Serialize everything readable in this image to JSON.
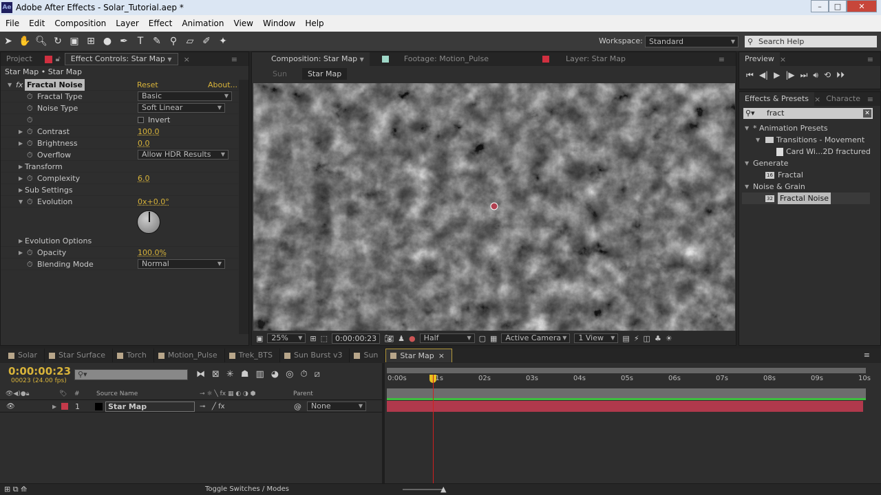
{
  "window": {
    "app_icon": "Ae",
    "title": "Adobe After Effects - Solar_Tutorial.aep *"
  },
  "menu": [
    "File",
    "Edit",
    "Composition",
    "Layer",
    "Effect",
    "Animation",
    "View",
    "Window",
    "Help"
  ],
  "toolbar": {
    "workspace_label": "Workspace:",
    "workspace_value": "Standard",
    "search_placeholder": "Search Help"
  },
  "left_panel": {
    "tabs": [
      "Project",
      "Effect Controls: Star Map"
    ],
    "breadcrumb": "Star Map • Star Map",
    "effect": {
      "name": "Fractal Noise",
      "reset": "Reset",
      "about": "About...",
      "properties": [
        {
          "label": "Fractal Type",
          "value": "Basic",
          "kind": "dropdown"
        },
        {
          "label": "Noise Type",
          "value": "Soft Linear",
          "kind": "dropdown"
        },
        {
          "label": "",
          "value": "Invert",
          "kind": "checkbox",
          "checked": false
        },
        {
          "label": "Contrast",
          "value": "100.0",
          "kind": "number"
        },
        {
          "label": "Brightness",
          "value": "0.0",
          "kind": "number"
        },
        {
          "label": "Overflow",
          "value": "Allow HDR Results",
          "kind": "dropdown"
        },
        {
          "label": "Transform",
          "value": "",
          "kind": "group"
        },
        {
          "label": "Complexity",
          "value": "6.0",
          "kind": "number"
        },
        {
          "label": "Sub Settings",
          "value": "",
          "kind": "group"
        },
        {
          "label": "Evolution",
          "value": "0x+0.0°",
          "kind": "number"
        },
        {
          "label": "Evolution Options",
          "value": "",
          "kind": "group"
        },
        {
          "label": "Opacity",
          "value": "100.0%",
          "kind": "number"
        },
        {
          "label": "Blending Mode",
          "value": "Normal",
          "kind": "dropdown"
        }
      ]
    }
  },
  "viewer": {
    "tabs": [
      "Composition: Star Map",
      "Footage: Motion_Pulse",
      "Layer: Star Map"
    ],
    "flow": [
      "Sun",
      "Star Map"
    ],
    "footer": {
      "zoom": "25%",
      "timecode": "0:00:00:23",
      "resolution": "Half",
      "camera": "Active Camera",
      "views": "1 View"
    }
  },
  "preview": {
    "tab": "Preview"
  },
  "effects_presets": {
    "tabs": [
      "Effects & Presets",
      "Characte"
    ],
    "search": "fract",
    "tree": [
      {
        "label": "* Animation Presets",
        "depth": 0,
        "type": "category"
      },
      {
        "label": "Transitions - Movement",
        "depth": 1,
        "type": "folder"
      },
      {
        "label": "Card Wi...2D fractured",
        "depth": 2,
        "type": "preset"
      },
      {
        "label": "Generate",
        "depth": 0,
        "type": "category"
      },
      {
        "label": "Fractal",
        "depth": 1,
        "type": "effect",
        "bits": "16"
      },
      {
        "label": "Noise & Grain",
        "depth": 0,
        "type": "category"
      },
      {
        "label": "Fractal Noise",
        "depth": 1,
        "type": "effect",
        "bits": "32",
        "selected": true
      }
    ]
  },
  "timeline": {
    "tabs": [
      "Solar",
      "Star Surface",
      "Torch",
      "Motion_Pulse",
      "Trek_BTS",
      "Sun Burst v3",
      "Sun",
      "Star Map"
    ],
    "timecode": "0:00:00:23",
    "frames": "00023 (24.00 fps)",
    "columns": {
      "num": "#",
      "source": "Source Name",
      "parent": "Parent"
    },
    "layer": {
      "index": "1",
      "name": "Star Map",
      "parent": "None",
      "color": "#c43a4a"
    },
    "ruler": [
      "0:00s",
      "01s",
      "02s",
      "03s",
      "04s",
      "05s",
      "06s",
      "07s",
      "08s",
      "09s",
      "10s"
    ],
    "current_time_s": 0.96,
    "toggle_label": "Toggle Switches / Modes"
  },
  "colors": {
    "accent": "#d9b43a",
    "layer_bar": "#b0394c",
    "playhead": "#d02020",
    "work_area": "#3fbf3f"
  }
}
